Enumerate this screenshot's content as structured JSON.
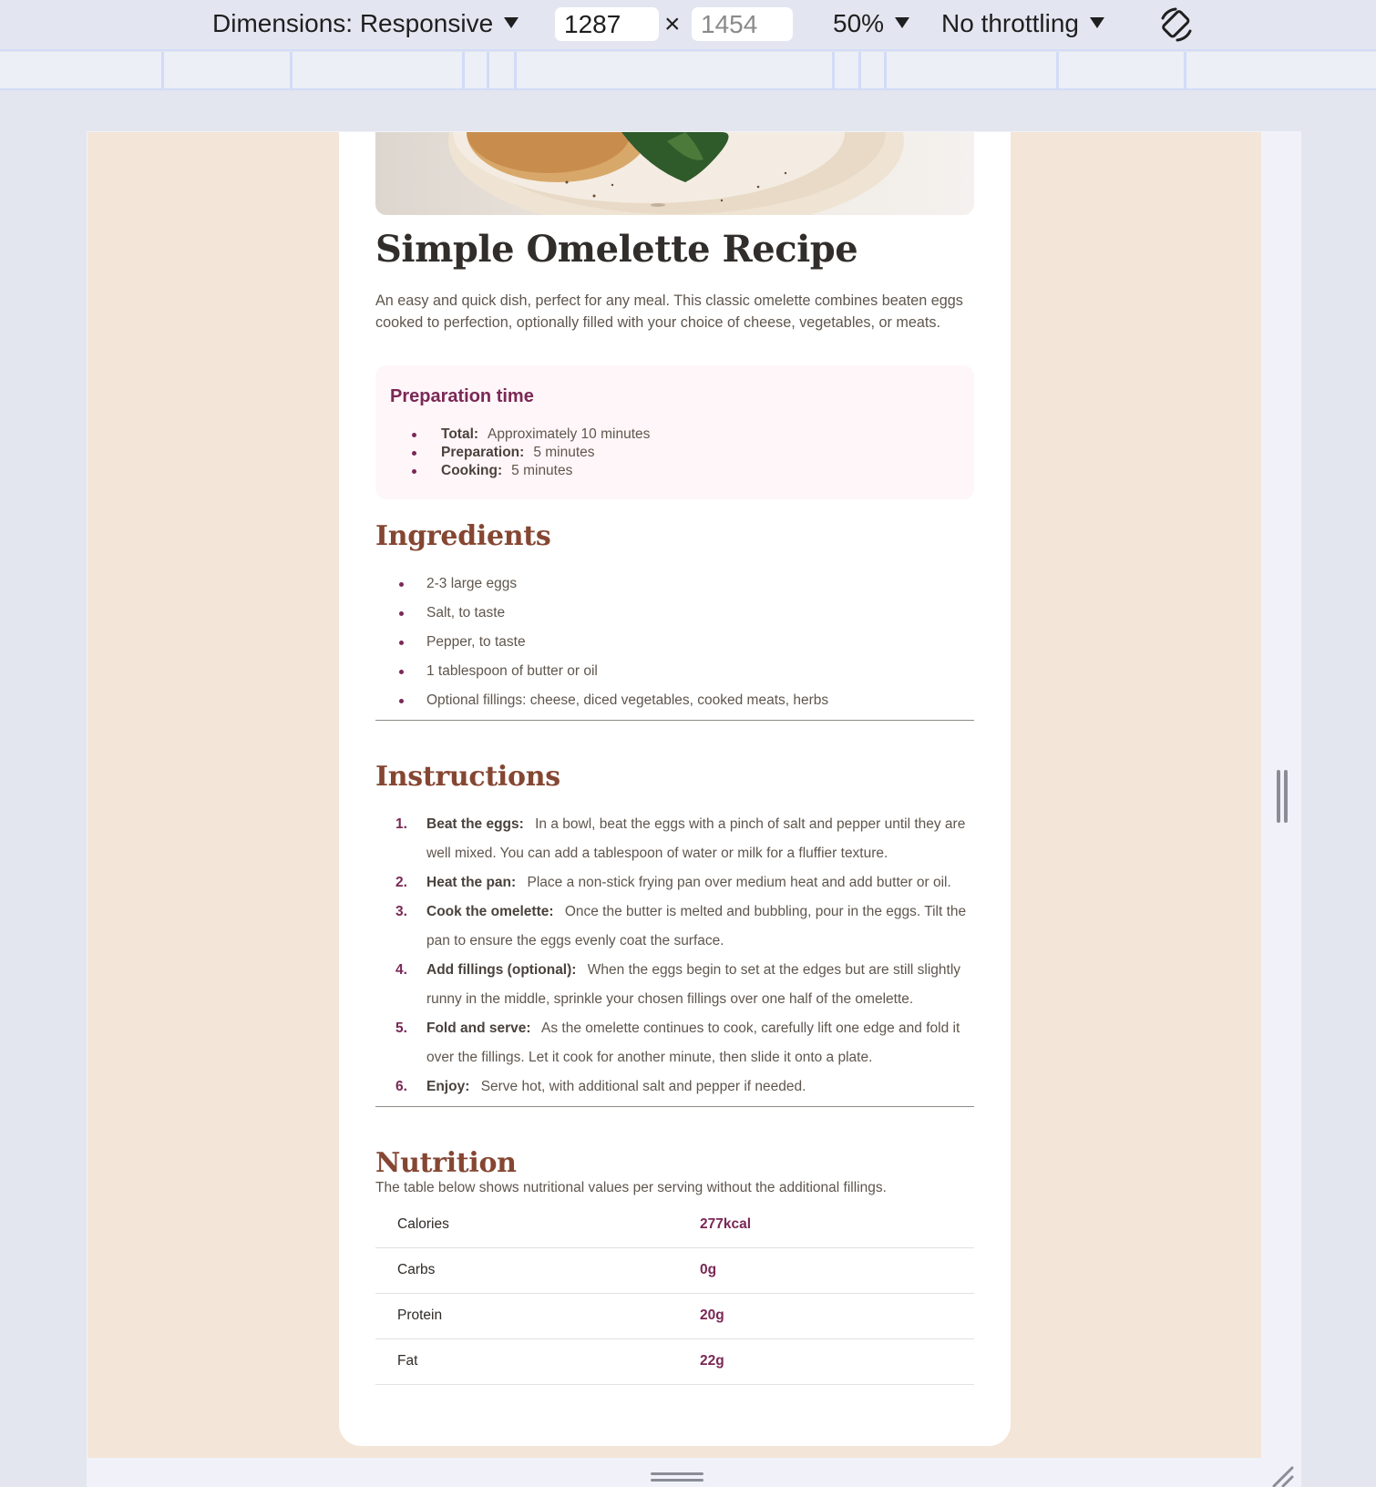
{
  "devtools": {
    "dimensions_label": "Dimensions: Responsive",
    "width_value": "1287",
    "height_value": "1454",
    "times_symbol": "×",
    "zoom_label": "50%",
    "throttling_label": "No throttling",
    "icons": [
      "caret-down-icon",
      "rotate-icon",
      "resize-handle-icon",
      "corner-grip-icon"
    ]
  },
  "recipe": {
    "title": "Simple Omelette Recipe",
    "intro": "An easy and quick dish, perfect for any meal. This classic omelette combines beaten eggs cooked to perfection, optionally filled with your choice of cheese, vegetables, or meats.",
    "prep": {
      "heading": "Preparation time",
      "items": [
        {
          "label": "Total:",
          "value": "Approximately 10 minutes"
        },
        {
          "label": "Preparation:",
          "value": "5 minutes"
        },
        {
          "label": "Cooking:",
          "value": "5 minutes"
        }
      ]
    },
    "ingredients": {
      "heading": "Ingredients",
      "items": [
        "2-3 large eggs",
        "Salt, to taste",
        "Pepper, to taste",
        "1 tablespoon of butter or oil",
        "Optional fillings: cheese, diced vegetables, cooked meats, herbs"
      ]
    },
    "instructions": {
      "heading": "Instructions",
      "items": [
        {
          "num": "1.",
          "label": "Beat the eggs:",
          "text": "In a bowl, beat the eggs with a pinch of salt and pepper until they are well mixed. You can add a tablespoon of water or milk for a fluffier texture."
        },
        {
          "num": "2.",
          "label": "Heat the pan:",
          "text": "Place a non-stick frying pan over medium heat and add butter or oil."
        },
        {
          "num": "3.",
          "label": "Cook the omelette:",
          "text": "Once the butter is melted and bubbling, pour in the eggs. Tilt the pan to ensure the eggs evenly coat the surface."
        },
        {
          "num": "4.",
          "label": "Add fillings (optional):",
          "text": "When the eggs begin to set at the edges but are still slightly runny in the middle, sprinkle your chosen fillings over one half of the omelette."
        },
        {
          "num": "5.",
          "label": "Fold and serve:",
          "text": "As the omelette continues to cook, carefully lift one edge and fold it over the fillings. Let it cook for another minute, then slide it onto a plate."
        },
        {
          "num": "6.",
          "label": "Enjoy:",
          "text": "Serve hot, with additional salt and pepper if needed."
        }
      ]
    },
    "nutrition": {
      "heading": "Nutrition",
      "intro": "The table below shows nutritional values per serving without the additional fillings.",
      "rows": [
        {
          "name": "Calories",
          "value": "277kcal"
        },
        {
          "name": "Carbs",
          "value": "0g"
        },
        {
          "name": "Protein",
          "value": "20g"
        },
        {
          "name": "Fat",
          "value": "22g"
        }
      ]
    }
  },
  "colors": {
    "page_bg": "#f3e5d7",
    "card_bg": "#ffffff",
    "heading": "#312d2b",
    "section_heading": "#854632",
    "accent": "#7a2855",
    "prep_bg": "#fff6f9",
    "devtools_bg": "#e3e6f0"
  }
}
